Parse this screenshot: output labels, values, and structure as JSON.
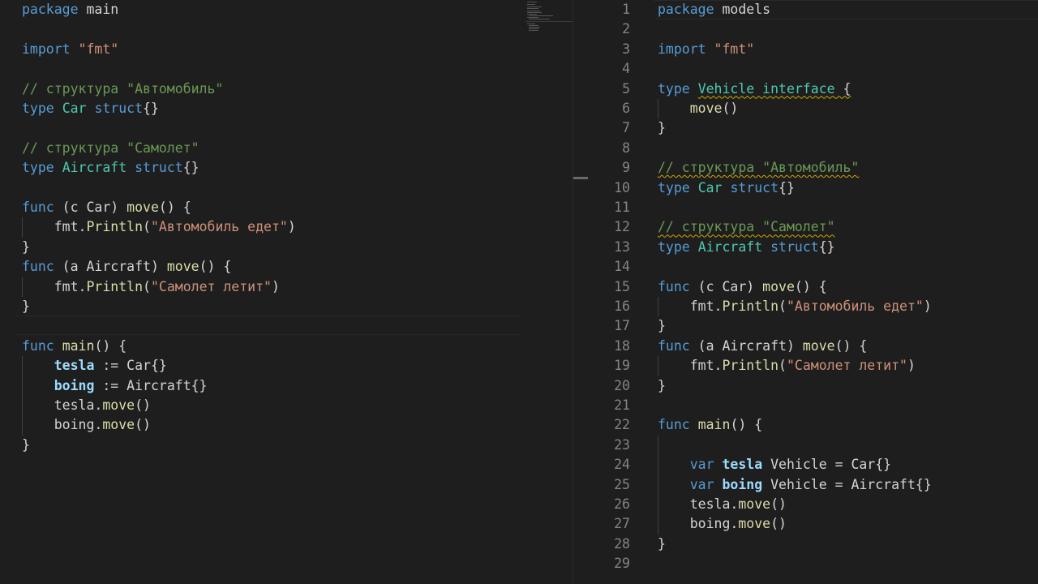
{
  "left_editor": {
    "lines": [
      [
        {
          "t": "package",
          "c": "kw"
        },
        {
          "t": " main",
          "c": "pl"
        }
      ],
      [],
      [
        {
          "t": "import",
          "c": "kw"
        },
        {
          "t": " ",
          "c": "pl"
        },
        {
          "t": "\"fmt\"",
          "c": "st"
        }
      ],
      [],
      [
        {
          "t": "// структура \"Автомобиль\"",
          "c": "cm"
        }
      ],
      [
        {
          "t": "type",
          "c": "kw"
        },
        {
          "t": " ",
          "c": "pl"
        },
        {
          "t": "Car",
          "c": "ty"
        },
        {
          "t": " ",
          "c": "pl"
        },
        {
          "t": "struct",
          "c": "kw"
        },
        {
          "t": "{}",
          "c": "pl"
        }
      ],
      [],
      [
        {
          "t": "// структура \"Самолет\"",
          "c": "cm"
        }
      ],
      [
        {
          "t": "type",
          "c": "kw"
        },
        {
          "t": " ",
          "c": "pl"
        },
        {
          "t": "Aircraft",
          "c": "ty"
        },
        {
          "t": " ",
          "c": "pl"
        },
        {
          "t": "struct",
          "c": "kw"
        },
        {
          "t": "{}",
          "c": "pl"
        }
      ],
      [],
      [
        {
          "t": "func",
          "c": "kw"
        },
        {
          "t": " (c Car) ",
          "c": "pl"
        },
        {
          "t": "move",
          "c": "fn"
        },
        {
          "t": "() {",
          "c": "pl"
        }
      ],
      [
        {
          "t": "    fmt.",
          "c": "pl"
        },
        {
          "t": "Println",
          "c": "fn"
        },
        {
          "t": "(",
          "c": "pl"
        },
        {
          "t": "\"Автомобиль едет\"",
          "c": "st"
        },
        {
          "t": ")",
          "c": "pl"
        }
      ],
      [
        {
          "t": "}",
          "c": "pl"
        }
      ],
      [
        {
          "t": "func",
          "c": "kw"
        },
        {
          "t": " (a Aircraft) ",
          "c": "pl"
        },
        {
          "t": "move",
          "c": "fn"
        },
        {
          "t": "() {",
          "c": "pl"
        }
      ],
      [
        {
          "t": "    fmt.",
          "c": "pl"
        },
        {
          "t": "Println",
          "c": "fn"
        },
        {
          "t": "(",
          "c": "pl"
        },
        {
          "t": "\"Самолет летит\"",
          "c": "st"
        },
        {
          "t": ")",
          "c": "pl"
        }
      ],
      [
        {
          "t": "}",
          "c": "pl"
        }
      ],
      [],
      [
        {
          "t": "func",
          "c": "kw"
        },
        {
          "t": " ",
          "c": "pl"
        },
        {
          "t": "main",
          "c": "fn"
        },
        {
          "t": "() {",
          "c": "pl"
        }
      ],
      [
        {
          "t": "    ",
          "c": "pl"
        },
        {
          "t": "tesla",
          "c": "vb"
        },
        {
          "t": " := Car{}",
          "c": "pl"
        }
      ],
      [
        {
          "t": "    ",
          "c": "pl"
        },
        {
          "t": "boing",
          "c": "vb"
        },
        {
          "t": " := Aircraft{}",
          "c": "pl"
        }
      ],
      [
        {
          "t": "    tesla.",
          "c": "pl"
        },
        {
          "t": "move",
          "c": "fn"
        },
        {
          "t": "()",
          "c": "pl"
        }
      ],
      [
        {
          "t": "    boing.",
          "c": "pl"
        },
        {
          "t": "move",
          "c": "fn"
        },
        {
          "t": "()",
          "c": "pl"
        }
      ],
      [
        {
          "t": "}",
          "c": "pl"
        }
      ]
    ]
  },
  "right_editor": {
    "line_numbers": [
      "1",
      "2",
      "3",
      "4",
      "5",
      "6",
      "7",
      "8",
      "9",
      "10",
      "11",
      "12",
      "13",
      "14",
      "15",
      "16",
      "17",
      "18",
      "19",
      "20",
      "21",
      "22",
      "23",
      "24",
      "25",
      "26",
      "27",
      "28",
      "29"
    ],
    "lines": [
      [
        {
          "t": "package",
          "c": "kw"
        },
        {
          "t": " models",
          "c": "pl"
        }
      ],
      [],
      [
        {
          "t": "import",
          "c": "kw"
        },
        {
          "t": " ",
          "c": "pl"
        },
        {
          "t": "\"fmt\"",
          "c": "st"
        }
      ],
      [],
      [
        {
          "t": "type",
          "c": "kw"
        },
        {
          "t": " ",
          "c": "pl"
        },
        {
          "t": "Vehicle interface",
          "c": "ty squig"
        },
        {
          "t": " {",
          "c": "pl squig"
        }
      ],
      [
        {
          "t": "    ",
          "c": "pl"
        },
        {
          "t": "move",
          "c": "fn"
        },
        {
          "t": "()",
          "c": "pl"
        }
      ],
      [
        {
          "t": "}",
          "c": "pl"
        }
      ],
      [],
      [
        {
          "t": "// структура \"Автомобиль\"",
          "c": "cm squig"
        }
      ],
      [
        {
          "t": "type",
          "c": "kw"
        },
        {
          "t": " ",
          "c": "pl"
        },
        {
          "t": "Car",
          "c": "ty"
        },
        {
          "t": " ",
          "c": "pl"
        },
        {
          "t": "struct",
          "c": "kw"
        },
        {
          "t": "{}",
          "c": "pl"
        }
      ],
      [],
      [
        {
          "t": "// структура \"Самолет\"",
          "c": "cm squig"
        }
      ],
      [
        {
          "t": "type",
          "c": "kw"
        },
        {
          "t": " ",
          "c": "pl"
        },
        {
          "t": "Aircraft",
          "c": "ty"
        },
        {
          "t": " ",
          "c": "pl"
        },
        {
          "t": "struct",
          "c": "kw"
        },
        {
          "t": "{}",
          "c": "pl"
        }
      ],
      [],
      [
        {
          "t": "func",
          "c": "kw"
        },
        {
          "t": " (c Car) ",
          "c": "pl"
        },
        {
          "t": "move",
          "c": "fn"
        },
        {
          "t": "() {",
          "c": "pl"
        }
      ],
      [
        {
          "t": "    fmt.",
          "c": "pl"
        },
        {
          "t": "Println",
          "c": "fn"
        },
        {
          "t": "(",
          "c": "pl"
        },
        {
          "t": "\"Автомобиль едет\"",
          "c": "st"
        },
        {
          "t": ")",
          "c": "pl"
        }
      ],
      [
        {
          "t": "}",
          "c": "pl"
        }
      ],
      [
        {
          "t": "func",
          "c": "kw"
        },
        {
          "t": " (a Aircraft) ",
          "c": "pl"
        },
        {
          "t": "move",
          "c": "fn"
        },
        {
          "t": "() {",
          "c": "pl"
        }
      ],
      [
        {
          "t": "    fmt.",
          "c": "pl"
        },
        {
          "t": "Println",
          "c": "fn"
        },
        {
          "t": "(",
          "c": "pl"
        },
        {
          "t": "\"Самолет летит\"",
          "c": "st"
        },
        {
          "t": ")",
          "c": "pl"
        }
      ],
      [
        {
          "t": "}",
          "c": "pl"
        }
      ],
      [],
      [
        {
          "t": "func",
          "c": "kw"
        },
        {
          "t": " ",
          "c": "pl"
        },
        {
          "t": "main",
          "c": "fn"
        },
        {
          "t": "() {",
          "c": "pl"
        }
      ],
      [],
      [
        {
          "t": "    ",
          "c": "pl"
        },
        {
          "t": "var",
          "c": "kw"
        },
        {
          "t": " ",
          "c": "pl"
        },
        {
          "t": "tesla",
          "c": "vb"
        },
        {
          "t": " Vehicle = Car{}",
          "c": "pl"
        }
      ],
      [
        {
          "t": "    ",
          "c": "pl"
        },
        {
          "t": "var",
          "c": "kw"
        },
        {
          "t": " ",
          "c": "pl"
        },
        {
          "t": "boing",
          "c": "vb"
        },
        {
          "t": " Vehicle = Aircraft{}",
          "c": "pl"
        }
      ],
      [
        {
          "t": "    tesla.",
          "c": "pl"
        },
        {
          "t": "move",
          "c": "fn"
        },
        {
          "t": "()",
          "c": "pl"
        }
      ],
      [
        {
          "t": "    boing.",
          "c": "pl"
        },
        {
          "t": "move",
          "c": "fn"
        },
        {
          "t": "()",
          "c": "pl"
        }
      ],
      [
        {
          "t": "}",
          "c": "pl"
        }
      ],
      []
    ]
  }
}
